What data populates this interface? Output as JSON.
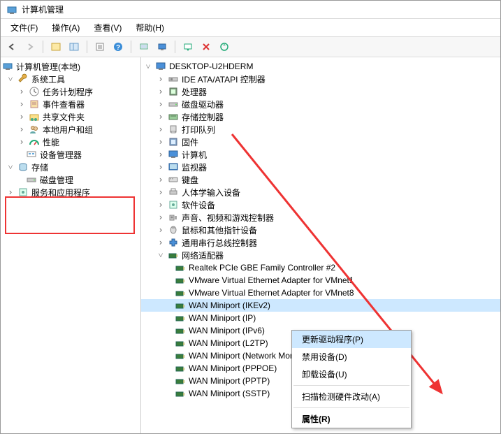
{
  "title": "计算机管理",
  "menus": {
    "file": "文件(F)",
    "action": "操作(A)",
    "view": "查看(V)",
    "help": "帮助(H)"
  },
  "left": {
    "root": "计算机管理(本地)",
    "sys": "系统工具",
    "tasks": "任务计划程序",
    "events": "事件查看器",
    "shared": "共享文件夹",
    "users": "本地用户和组",
    "perf": "性能",
    "devmgr": "设备管理器",
    "storage": "存储",
    "diskmgmt": "磁盘管理",
    "services": "服务和应用程序"
  },
  "right": {
    "computer": "DESKTOP-U2HDERM",
    "categories": [
      "IDE ATA/ATAPI 控制器",
      "处理器",
      "磁盘驱动器",
      "存储控制器",
      "打印队列",
      "固件",
      "计算机",
      "监视器",
      "键盘",
      "人体学输入设备",
      "软件设备",
      "声音、视频和游戏控制器",
      "鼠标和其他指针设备",
      "通用串行总线控制器"
    ],
    "netCat": "网络适配器",
    "net": [
      "Realtek PCIe GBE Family Controller #2",
      "VMware Virtual Ethernet Adapter for VMnet1",
      "VMware Virtual Ethernet Adapter for VMnet8",
      "WAN Miniport (IKEv2)",
      "WAN Miniport (IP)",
      "WAN Miniport (IPv6)",
      "WAN Miniport (L2TP)",
      "WAN Miniport (Network Monitor)",
      "WAN Miniport (PPPOE)",
      "WAN Miniport (PPTP)",
      "WAN Miniport (SSTP)"
    ]
  },
  "ctx": {
    "update": "更新驱动程序(P)",
    "disable": "禁用设备(D)",
    "uninstall": "卸载设备(U)",
    "scan": "扫描检测硬件改动(A)",
    "props": "属性(R)"
  }
}
